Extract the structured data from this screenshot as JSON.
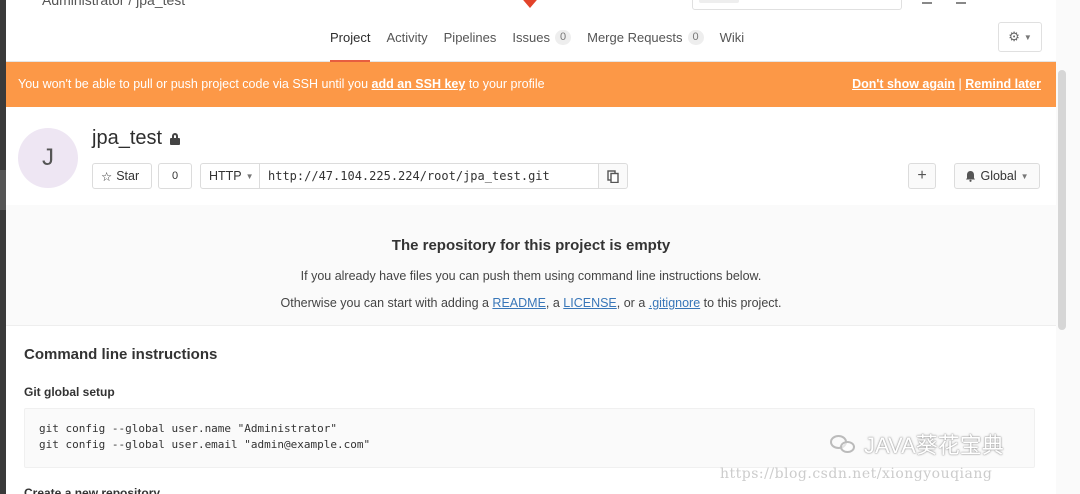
{
  "topbar": {
    "breadcrumb": "Administrator / jpa_test"
  },
  "nav": {
    "items": [
      {
        "label": "Project",
        "active": true
      },
      {
        "label": "Activity"
      },
      {
        "label": "Pipelines"
      },
      {
        "label": "Issues",
        "count": "0"
      },
      {
        "label": "Merge Requests",
        "count": "0"
      },
      {
        "label": "Wiki"
      }
    ]
  },
  "alert": {
    "prefix": "You won't be able to pull or push project code via SSH until you ",
    "link": "add an SSH key",
    "suffix": " to your profile",
    "dismiss": "Don't show again",
    "separator": "|",
    "remind": "Remind later",
    "color": "#fc9847"
  },
  "project": {
    "avatar_letter": "J",
    "name": "jpa_test",
    "star_label": "Star",
    "star_count": "0",
    "protocol": "HTTP",
    "clone_url": "http://47.104.225.224/root/jpa_test.git",
    "notification": "Global"
  },
  "empty_state": {
    "title": "The repository for this project is empty",
    "line1": "If you already have files you can push them using command line instructions below.",
    "line2_prefix": "Otherwise you can start with adding a ",
    "readme": "README",
    "sep1": ", a ",
    "license": "LICENSE",
    "sep2": ", or a ",
    "gitignore": ".gitignore",
    "line2_suffix": " to this project."
  },
  "cli": {
    "title": "Command line instructions",
    "global_setup": "Git global setup",
    "code": "git config --global user.name \"Administrator\"\ngit config --global user.email \"admin@example.com\"",
    "next_heading": "Create a new repository"
  },
  "watermark": {
    "text": "JAVA葵花宝典",
    "url": "https://blog.csdn.net/xiongyouqiang"
  },
  "colors": {
    "accent": "#e75e40",
    "link": "#3876b8"
  }
}
